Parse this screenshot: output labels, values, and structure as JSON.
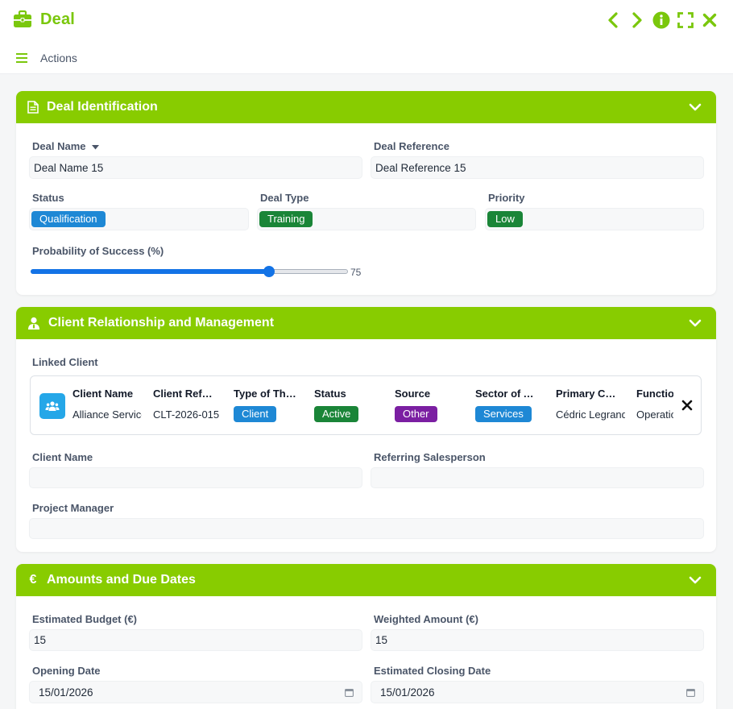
{
  "window": {
    "title": "Deal"
  },
  "actions": {
    "label": "Actions"
  },
  "colors": {
    "accent": "#88cc00",
    "title": "#7ac70c",
    "blue_badge": "#1e88d5",
    "green_badge": "#1a8538",
    "purple_badge": "#7b1fa2",
    "avatar": "#25a7e8",
    "slider": "#1373e6"
  },
  "icons": {
    "title": "briefcase-icon",
    "actions": "hamburger-menu-icon",
    "prev": "chevron-left-icon",
    "next": "chevron-right-icon",
    "info": "info-icon",
    "fullscreen": "fullscreen-icon",
    "close": "close-icon"
  },
  "deal_identification": {
    "title": "Deal Identification",
    "deal_name": {
      "label": "Deal Name",
      "value": "Deal Name 15"
    },
    "deal_reference": {
      "label": "Deal Reference",
      "value": "Deal Reference 15"
    },
    "status": {
      "label": "Status",
      "value": "Qualification"
    },
    "deal_type": {
      "label": "Deal Type",
      "value": "Training"
    },
    "priority": {
      "label": "Priority",
      "value": "Low"
    },
    "probability": {
      "label": "Probability of Success (%)",
      "value": 75,
      "display": "75"
    }
  },
  "client_relationship": {
    "title": "Client Relationship and Management",
    "linked_client": {
      "label": "Linked Client",
      "columns": [
        {
          "header": "Client Name",
          "value": "Alliance Services"
        },
        {
          "header": "Client Reference",
          "value": "CLT-2026-015"
        },
        {
          "header": "Type of Third Party",
          "value": "Client"
        },
        {
          "header": "Status",
          "value": "Active"
        },
        {
          "header": "Source",
          "value": "Other"
        },
        {
          "header": "Sector of Activity",
          "value": "Services"
        },
        {
          "header": "Primary Contact",
          "value": "Cédric Legrand"
        },
        {
          "header": "Function",
          "value": "Operations"
        }
      ]
    },
    "client_name": {
      "label": "Client Name",
      "value": ""
    },
    "referring_salesperson": {
      "label": "Referring Salesperson",
      "value": ""
    },
    "project_manager": {
      "label": "Project Manager",
      "value": ""
    }
  },
  "amounts": {
    "title": "Amounts and Due Dates",
    "estimated_budget": {
      "label": "Estimated Budget (€)",
      "value": "15"
    },
    "weighted_amount": {
      "label": "Weighted Amount (€)",
      "value": "15"
    },
    "opening_date": {
      "label": "Opening Date",
      "value": "15/01/2026"
    },
    "closing_date": {
      "label": "Estimated Closing Date",
      "value": "15/01/2026"
    }
  }
}
